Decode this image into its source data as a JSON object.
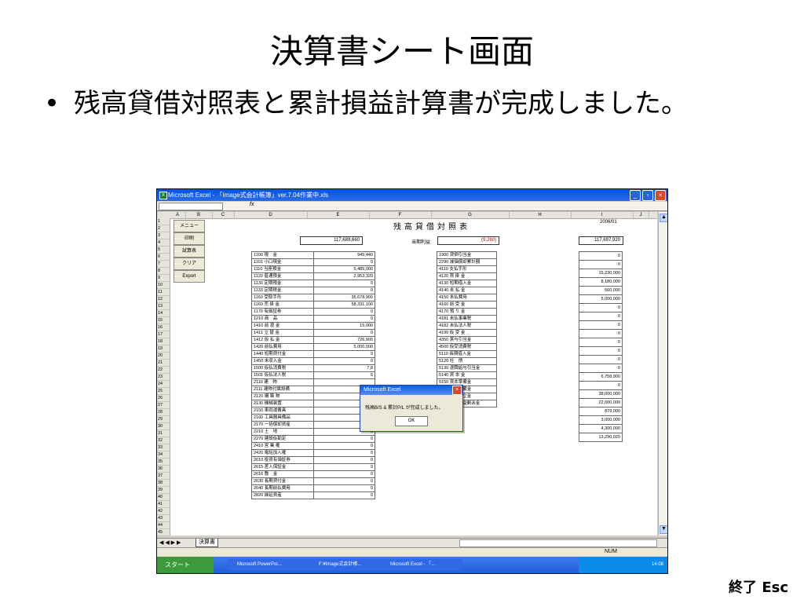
{
  "slide": {
    "title": "決算書シート画面",
    "bullet": "残高貸借対照表と累計損益計算書が完成しました。",
    "end_key": "終了 Esc"
  },
  "excel": {
    "window_title": "Microsoft Excel - 「Image式会計帳簿」ver.7.04作業中.xls",
    "formula_icon": "fx",
    "columns": [
      "A",
      "B",
      "C",
      "D",
      "E",
      "F",
      "G",
      "H",
      "I",
      "J"
    ],
    "row_numbers": [
      "1",
      "2",
      "3",
      "4",
      "5",
      "6",
      "7",
      "8",
      "9",
      "10",
      "11",
      "12",
      "13",
      "14",
      "15",
      "16",
      "17",
      "18",
      "19",
      "20",
      "21",
      "22",
      "23",
      "24",
      "25",
      "26",
      "27",
      "28",
      "29",
      "30",
      "31",
      "32",
      "33",
      "34",
      "35",
      "36",
      "37",
      "38",
      "39",
      "40",
      "41",
      "42",
      "43",
      "44",
      "45"
    ],
    "menu_buttons": [
      "メニュー",
      "印刷",
      "試算表",
      "クリア",
      "Export"
    ],
    "sheet_title": "残高貸借対照表",
    "date": "2006/01",
    "top_left_total": "117,689,660",
    "profit_label": "当期利益:",
    "profit_value": "(9,260)",
    "top_right_total": "117,697,920",
    "assets": [
      [
        "1100 現　金",
        "945,440"
      ],
      [
        "1101 小口現金",
        "0"
      ],
      [
        "1110 当座預金",
        "5,485,000"
      ],
      [
        "1120 普通預金",
        "2,953,320"
      ],
      [
        "1130 定期預金",
        "0"
      ],
      [
        "1133 定期積金",
        "0"
      ],
      [
        "1150 受取手形",
        "35,678,900"
      ],
      [
        "1160 売 掛 金",
        "58,331,100"
      ],
      [
        "1170 有価証券",
        "0"
      ],
      [
        "1210 商　品",
        "0"
      ],
      [
        "1410 前 渡 金",
        "15,000"
      ],
      [
        "1411 立 替 金",
        "0"
      ],
      [
        "1412 仮 払 金",
        "726,900"
      ],
      [
        "1420 前払費用",
        "5,000,000"
      ],
      [
        "1440 短期貸付金",
        "0"
      ],
      [
        "1450 未収入金",
        "0"
      ],
      [
        "1500 仮払消費税",
        "7,8"
      ],
      [
        "1501 仮払法人税",
        "6"
      ],
      [
        "2110 建　物",
        ""
      ],
      [
        "2111 建物付属設備",
        ""
      ],
      [
        "2120 構 築 物",
        ""
      ],
      [
        "2130 機械装置",
        ""
      ],
      [
        "2150 車両運搬具",
        "0"
      ],
      [
        "2160 工具器具備品",
        "0"
      ],
      [
        "2170 一括償却資産",
        "0"
      ],
      [
        "2210 土　地",
        "0"
      ],
      [
        "2270 建設仮勘定",
        "0"
      ],
      [
        "2410 営 業 権",
        "0"
      ],
      [
        "2420 電話加入権",
        "0"
      ],
      [
        "2610 投資有価証券",
        "0"
      ],
      [
        "2615 差入保証金",
        "0"
      ],
      [
        "2616 敷　金",
        "0"
      ],
      [
        "2630 長期貸付金",
        "0"
      ],
      [
        "2640 長期前払費用",
        "0"
      ],
      [
        "2820 繰延資産",
        "0"
      ]
    ],
    "liabilities": [
      "1900 貸倒引当金",
      "2290 減価償却累計額",
      "4110 支払手形",
      "4120 買 掛 金",
      "4130 短期借入金",
      "4140 未 払 金",
      "4150 未払費用",
      "4160 前 受 金",
      "4170 預 り 金",
      "4181 未払事業税",
      "4182 未払法人税",
      "4190 仮 受 金",
      "4350 賞与引当金",
      "4500 仮受消費税",
      "5110 長期借入金",
      "5120 社　債",
      "5130 退職給与引当金",
      "5140 資 本 金",
      "5150 資本準備金",
      "5160 利益準備金",
      "5170 任意積立金",
      "5180 繰越利益剰余金"
    ],
    "liability_values": [
      "0",
      "0",
      "15,230,000",
      "8,180,000",
      "560,000",
      "5,000,000",
      "0",
      "0",
      "0",
      "0",
      "0",
      "0",
      "0",
      "0",
      "6,758,900",
      "0",
      "38,000,000",
      "22,000,000",
      "879,000",
      "3,000,000",
      "4,300,000",
      "13,290,020"
    ],
    "dialog": {
      "title": "Microsoft Excel",
      "message": "残高B/S & 累計P/L が完成しました。",
      "ok": "OK"
    },
    "sheet_tab": "決算書",
    "status": "NUM",
    "taskbar": {
      "start": "スタート",
      "tasks": [
        "Microsoft PowerPoi...",
        "F:¥Image式会計帳...",
        "Microsoft Excel - 「..."
      ],
      "tray": "14:08"
    }
  }
}
